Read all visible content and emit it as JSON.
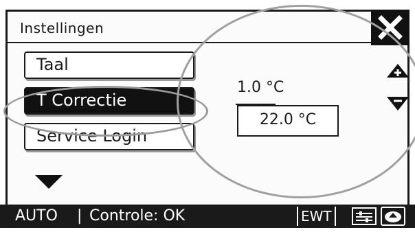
{
  "window": {
    "title": "Instellingen",
    "close_icon": "close-icon"
  },
  "menu": {
    "items": [
      {
        "label": "Taal",
        "selected": false
      },
      {
        "label": "T Correctie",
        "selected": true
      },
      {
        "label": "Service Login",
        "selected": false
      }
    ],
    "scroll_icon": "chevron-down-icon"
  },
  "correction": {
    "step": "1.0 °C",
    "value": "22.0 °C",
    "increase_icon": "arrow-up-icon",
    "decrease_icon": "arrow-down-icon"
  },
  "statusbar": {
    "mode": "AUTO",
    "separator": "|",
    "status": "Controle: OK",
    "ewt": "EWT"
  },
  "colors": {
    "dark": "#1a1a1a",
    "annotation": "#9a9a9a"
  }
}
